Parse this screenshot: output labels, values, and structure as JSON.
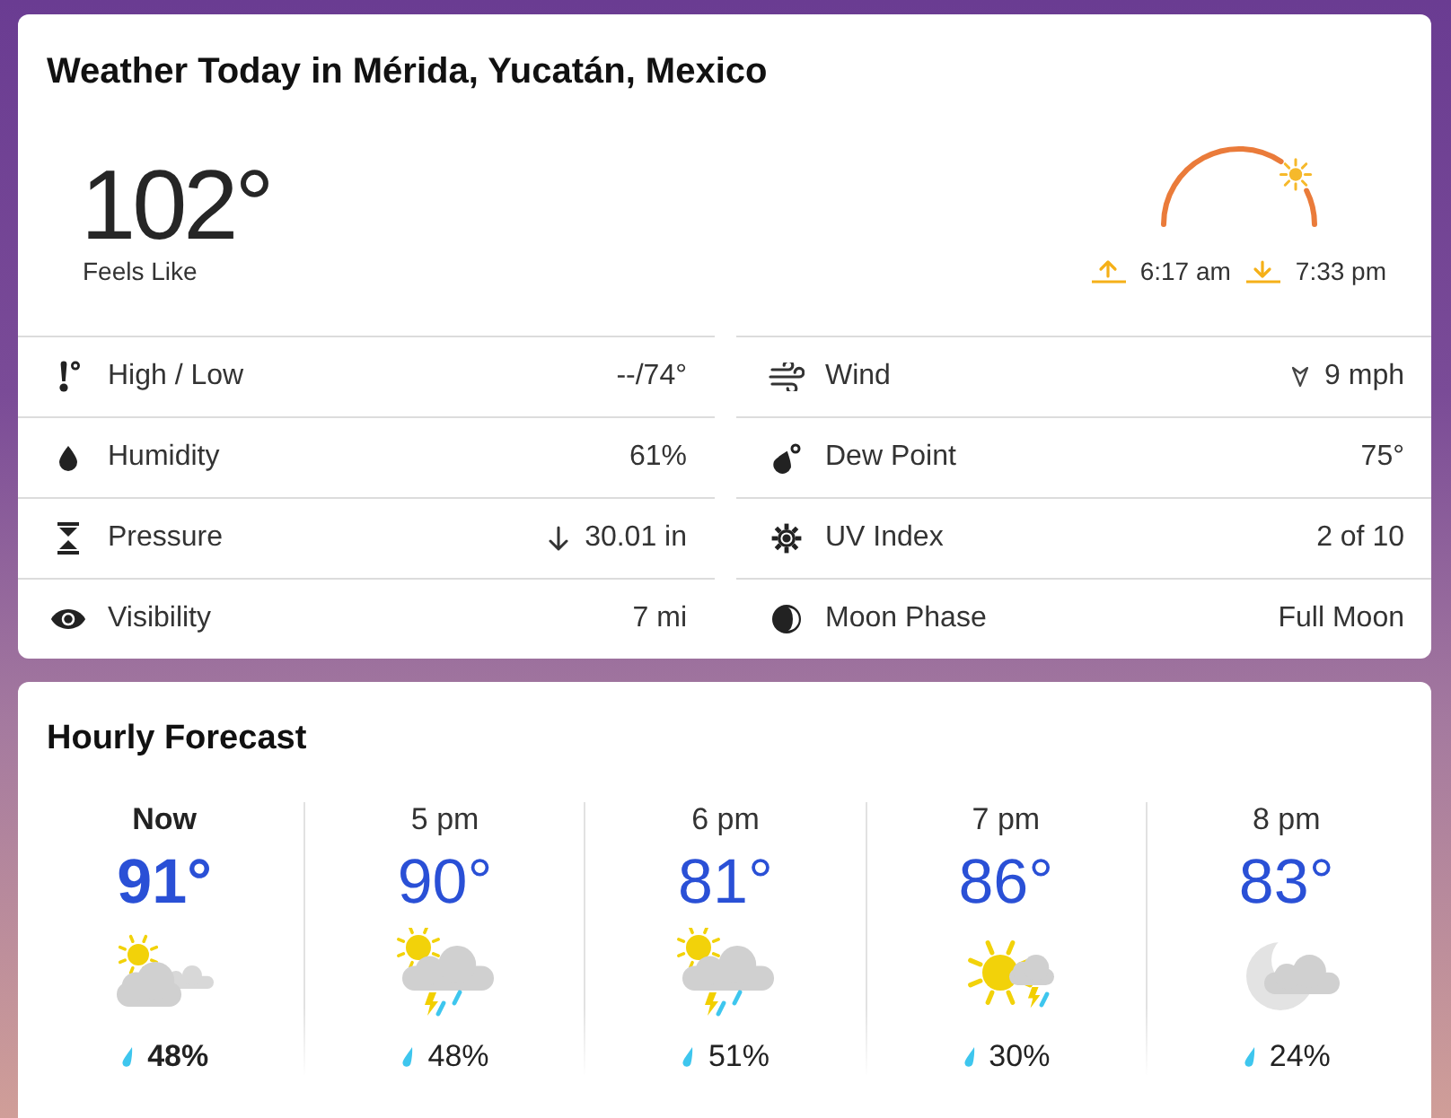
{
  "current": {
    "title": "Weather Today in Mérida, Yucatán, Mexico",
    "temperature": "102°",
    "feels_like": "Feels Like"
  },
  "sun": {
    "level": 0.77,
    "sunrise": "6:17 am",
    "sunset": "7:33 pm"
  },
  "details": [
    {
      "kind": "highlow",
      "label": "High / Low",
      "value": "--/74°"
    },
    {
      "kind": "wind",
      "label": "Wind",
      "value": "9 mph"
    },
    {
      "kind": "humidity",
      "label": "Humidity",
      "value": "61%"
    },
    {
      "kind": "dewpoint",
      "label": "Dew Point",
      "value": "75°"
    },
    {
      "kind": "pressure",
      "label": "Pressure",
      "value": "30.01 in",
      "falling": true
    },
    {
      "kind": "uv",
      "label": "UV Index",
      "value": "2 of 10"
    },
    {
      "kind": "visibility",
      "label": "Visibility",
      "value": "7 mi"
    },
    {
      "kind": "moon",
      "label": "Moon Phase",
      "value": "Full Moon"
    }
  ],
  "hourly": {
    "title": "Hourly Forecast",
    "hours": [
      {
        "time": "Now",
        "current": true,
        "temperature": "91°",
        "kind": "partlycloudy",
        "precipitation": "48%"
      },
      {
        "time": "5 pm",
        "current": false,
        "temperature": "90°",
        "kind": "storm",
        "precipitation": "48%"
      },
      {
        "time": "6 pm",
        "current": false,
        "temperature": "81°",
        "kind": "storm",
        "precipitation": "51%"
      },
      {
        "time": "7 pm",
        "current": false,
        "temperature": "86°",
        "kind": "sunstorm",
        "precipitation": "30%"
      },
      {
        "time": "8 pm",
        "current": false,
        "temperature": "83°",
        "kind": "night",
        "precipitation": "24%"
      }
    ]
  }
}
